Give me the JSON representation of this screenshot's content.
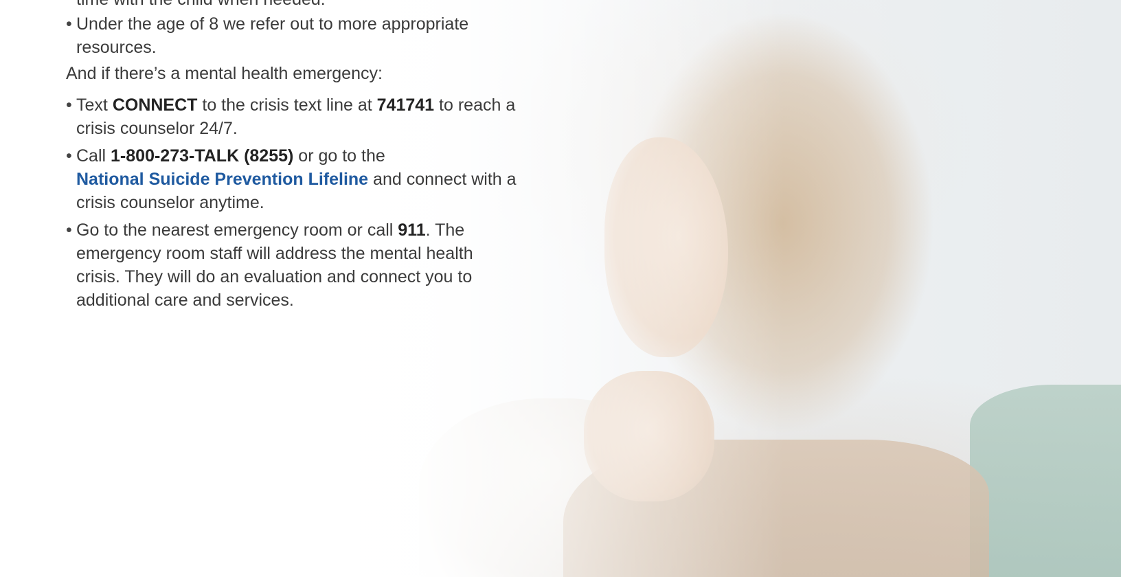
{
  "colors": {
    "link": "#1f5aa0",
    "text": "#3b3b3b",
    "bold": "#232323"
  },
  "cut_off_text": "time with the child when needed.",
  "age_bullet": "Under the age of 8 we refer out to more appropriate resources.",
  "emergency_intro": "And if there’s a mental health emergency:",
  "text_line": {
    "prefix": "Text",
    "keyword": "CONNECT",
    "middle": "to the crisis text line at",
    "number": "741741",
    "suffix": "to reach a crisis counselor 24/7."
  },
  "call_line": {
    "prefix": "Call",
    "number": "1-800-273-TALK (8255)",
    "middle": "or go to the",
    "link_text": "National Suicide Prevention Lifeline",
    "suffix": "and connect with a crisis counselor anytime."
  },
  "er_line": {
    "prefix": "Go to the nearest emergency room or call",
    "number": "911",
    "suffix": ". The emergency room staff will address the mental health crisis. They will do an evaluation and connect you to additional care and services."
  },
  "photo": {
    "description_icon": "woman-on-sofa-photo"
  }
}
